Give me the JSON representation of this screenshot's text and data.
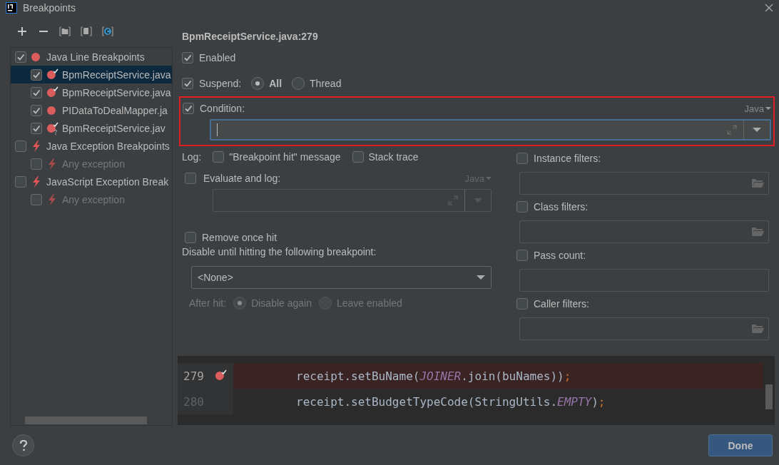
{
  "window": {
    "title": "Breakpoints"
  },
  "toolbar": [
    {
      "kind": "add"
    },
    {
      "kind": "remove"
    },
    {
      "kind": "group-package"
    },
    {
      "kind": "group-file"
    },
    {
      "kind": "group-class"
    }
  ],
  "tree": [
    {
      "label": "Java Line Breakpoints",
      "kind": "line",
      "checked": true,
      "selected": false,
      "disabled": false,
      "children": [
        {
          "label": "BpmReceiptService.java",
          "kind": "verified",
          "checked": true,
          "selected": true,
          "disabled": false
        },
        {
          "label": "BpmReceiptService.java",
          "kind": "verified",
          "checked": true,
          "selected": false,
          "disabled": false
        },
        {
          "label": "PIDataToDealMapper.ja",
          "kind": "line",
          "checked": true,
          "selected": false,
          "disabled": false
        },
        {
          "label": "BpmReceiptService.jav",
          "kind": "verified-conditional",
          "checked": true,
          "selected": false,
          "disabled": false
        }
      ]
    },
    {
      "label": "Java Exception Breakpoints",
      "kind": "exception",
      "checked": false,
      "selected": false,
      "disabled": false,
      "children": [
        {
          "label": "Any exception",
          "kind": "exception",
          "checked": false,
          "selected": false,
          "disabled": true
        }
      ]
    },
    {
      "label": "JavaScript Exception Break",
      "kind": "exception",
      "checked": false,
      "selected": false,
      "disabled": false,
      "children": [
        {
          "label": "Any exception",
          "kind": "exception",
          "checked": false,
          "selected": false,
          "disabled": true
        }
      ]
    }
  ],
  "details": {
    "heading": "BpmReceiptService.java:279",
    "enabled": {
      "label": "Enabled",
      "checked": true
    },
    "suspend": {
      "label": "Suspend:",
      "checked": true,
      "options": [
        {
          "label": "All",
          "selected": true
        },
        {
          "label": "Thread",
          "selected": false
        }
      ]
    },
    "condition": {
      "label": "Condition:",
      "checked": true,
      "language": "Java",
      "focused": true,
      "annotated": true
    },
    "log": {
      "label": "Log:",
      "options": [
        {
          "label": "\"Breakpoint hit\" message",
          "checked": false
        },
        {
          "label": "Stack trace",
          "checked": false
        }
      ]
    },
    "evaluate": {
      "label": "Evaluate and log:",
      "checked": false,
      "language": "Java"
    },
    "remove_once_hit": {
      "label": "Remove once hit",
      "checked": false
    },
    "disable_until": {
      "label": "Disable until hitting the following breakpoint:",
      "value": "<None>"
    },
    "after_hit": {
      "label": "After hit:",
      "disabled": true,
      "options": [
        {
          "label": "Disable again",
          "selected": true
        },
        {
          "label": "Leave enabled",
          "selected": false
        }
      ]
    },
    "filters": [
      {
        "label": "Instance filters:",
        "checked": false,
        "browse": true
      },
      {
        "label": "Class filters:",
        "checked": false,
        "browse": true
      },
      {
        "label": "Pass count:",
        "checked": false,
        "browse": false
      },
      {
        "label": "Caller filters:",
        "checked": false,
        "browse": true
      }
    ]
  },
  "editor": {
    "lines": [
      {
        "number": "279",
        "breakpoint": true,
        "current": true,
        "tokens": [
          {
            "kind": "plain",
            "text": "receipt.setBuName("
          },
          {
            "kind": "constant",
            "text": "JOINER"
          },
          {
            "kind": "plain",
            "text": ".join(buNames))"
          },
          {
            "kind": "keyword",
            "text": ";"
          }
        ]
      },
      {
        "number": "280",
        "breakpoint": false,
        "current": false,
        "tokens": [
          {
            "kind": "plain",
            "text": "receipt.setBudgetTypeCode(StringUtils."
          },
          {
            "kind": "constant",
            "text": "EMPTY"
          },
          {
            "kind": "plain",
            "text": ")"
          },
          {
            "kind": "keyword",
            "text": ";"
          }
        ]
      }
    ]
  },
  "footer": {
    "done": "Done"
  }
}
